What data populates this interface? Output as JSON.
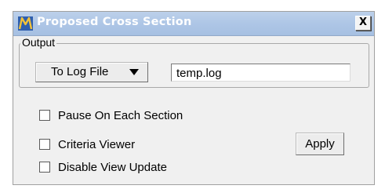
{
  "window": {
    "title": "Proposed Cross Section",
    "close_glyph": "X",
    "app_icon": "microstation-logo-icon"
  },
  "output_group": {
    "legend": "Output",
    "dropdown": {
      "selected": "To Log File"
    },
    "log_file": {
      "value": "temp.log"
    }
  },
  "options": [
    {
      "label": "Pause On Each Section",
      "checked": false
    },
    {
      "label": "Criteria Viewer",
      "checked": false
    },
    {
      "label": "Disable View Update",
      "checked": false
    }
  ],
  "apply_label": "Apply",
  "colors": {
    "titlebar": "#aec6e6",
    "dialog_bg": "#f0f0f0",
    "icon_blue": "#2f5fae"
  }
}
